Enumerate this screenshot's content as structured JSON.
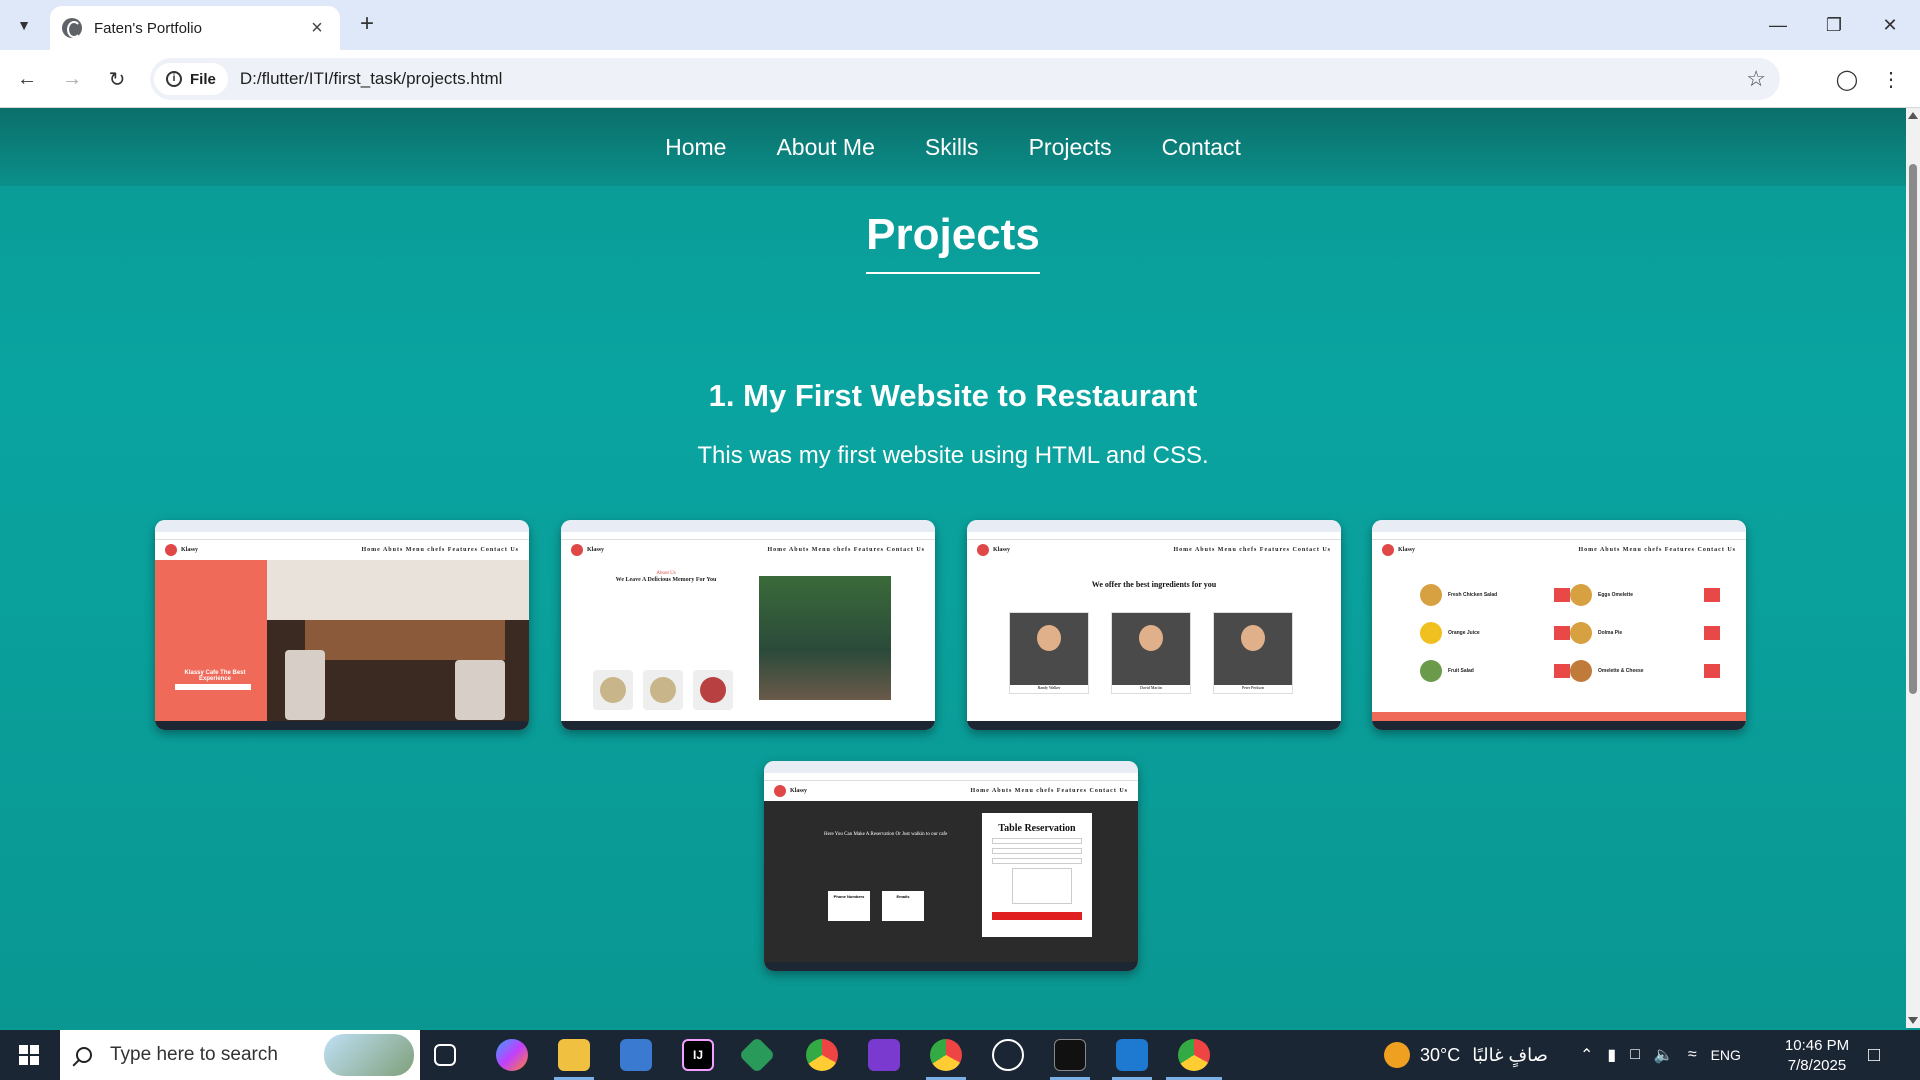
{
  "browser": {
    "tab_title": "Faten's Portfolio",
    "site_chip": "File",
    "url": "D:/flutter/ITI/first_task/projects.html"
  },
  "nav": {
    "items": [
      "Home",
      "About Me",
      "Skills",
      "Projects",
      "Contact"
    ]
  },
  "page": {
    "title": "Projects",
    "project_title": "1. My First Website to Restaurant",
    "project_desc": "This was my first website using HTML and CSS."
  },
  "screenshots": {
    "brand": "Klassy",
    "menu": "Home  Abuts  Menu  chefs  Features  Contact Us",
    "s1_hero": "Klassy Cafe The Best Experience",
    "s2_heading": "About Us",
    "s2_sub": "We Leave A Delicious Memory For You",
    "s3_heading": "We offer the best ingredients for you",
    "s3_chefs": [
      "Randy Walker",
      "David Martin",
      "Peter Perkson"
    ],
    "s4_items": [
      "Fresh Chicken Salad",
      "Eggs Omelette",
      "Orange Juice",
      "Dolma Pie",
      "Fruit Salad",
      "Omelette & Cheese"
    ],
    "s5_form_title": "Table Reservation",
    "s5_text": "Here You Can Make A Reservation Or Just walkin to our cafe",
    "s5_boxes": [
      "Phone Numbers",
      "Emails"
    ]
  },
  "taskbar": {
    "search_placeholder": "Type here to search",
    "weather": "30°C",
    "weather_desc": "صافٍ غالبًا",
    "lang": "ENG",
    "time": "10:46 PM",
    "date": "7/8/2025"
  },
  "colors": {
    "page_bg": "#0a9a94",
    "nav_bg": "#0b6f6a",
    "taskbar_bg": "#1b2634",
    "accent_red": "#f06a5a"
  }
}
